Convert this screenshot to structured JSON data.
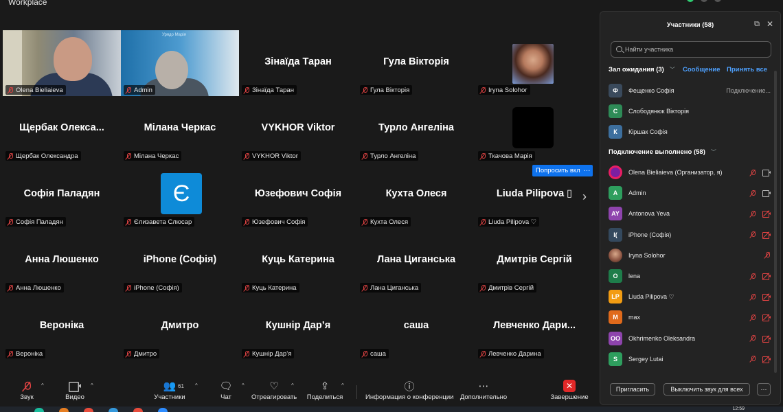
{
  "app_title": "Workplace",
  "gallery": {
    "tiles": [
      {
        "name": "Olena Bieliaieva",
        "display": "",
        "kind": "video1"
      },
      {
        "name": "Admin",
        "display": "",
        "kind": "video2"
      },
      {
        "name": "Зінаїда Таран",
        "display": "Зінаїда Таран",
        "kind": "name"
      },
      {
        "name": "Гула Вікторія",
        "display": "Гула Вікторія",
        "kind": "name"
      },
      {
        "name": "Iryna Solohor",
        "display": "",
        "kind": "photo"
      },
      {
        "name": "Щербак Олександра",
        "display": "Щербак  Олекса...",
        "kind": "name"
      },
      {
        "name": "Мілана Черкас",
        "display": "Мілана Черкас",
        "kind": "name"
      },
      {
        "name": "VYKHOR Viktor",
        "display": "VYKHOR Viktor",
        "kind": "name"
      },
      {
        "name": "Турло Ангеліна",
        "display": "Турло Ангеліна",
        "kind": "name"
      },
      {
        "name": "Ткачова Марія",
        "display": "",
        "kind": "black"
      },
      {
        "name": "Софія Паладян",
        "display": "Софія Паладян",
        "kind": "name"
      },
      {
        "name": "Єлизавета Слюсар",
        "display": "",
        "kind": "logo"
      },
      {
        "name": "Юзефович Софія",
        "display": "Юзефович Софія",
        "kind": "name"
      },
      {
        "name": "Кухта Олеся",
        "display": "Кухта Олеся",
        "kind": "name"
      },
      {
        "name": "Liuda Pilipova ♡",
        "display": "Liuda  Pilipova ▯",
        "kind": "name"
      },
      {
        "name": "Анна Люшенко",
        "display": "Анна Люшенко",
        "kind": "name"
      },
      {
        "name": "iPhone (Софія)",
        "display": "iPhone (Софія)",
        "kind": "name"
      },
      {
        "name": "Куць Катерина",
        "display": "Куць Катерина",
        "kind": "name"
      },
      {
        "name": "Лана Циганська",
        "display": "Лана Циганська",
        "kind": "name"
      },
      {
        "name": "Дмитрів Сергій",
        "display": "Дмитрів Сергій",
        "kind": "name"
      },
      {
        "name": "Вероніка",
        "display": "Вероніка",
        "kind": "name"
      },
      {
        "name": "Дмитро",
        "display": "Дмитро",
        "kind": "name"
      },
      {
        "name": "Кушнір Дар’я",
        "display": "Кушнір Дар’я",
        "kind": "name"
      },
      {
        "name": "саша",
        "display": "саша",
        "kind": "name"
      },
      {
        "name": "Левченко Дарина",
        "display": "Левченко  Дари...",
        "kind": "name"
      }
    ],
    "logo_letter": "Є",
    "video2_sign": "Урядо Марія",
    "ask_unmute": "Попросить вкл",
    "more": "···",
    "next": "›"
  },
  "toolbar": {
    "audio": "Звук",
    "video": "Видео",
    "participants": "Участники",
    "participants_count": "61",
    "chat": "Чат",
    "react": "Отреагировать",
    "share": "Поделиться",
    "info": "Информация о конференции",
    "more": "Дополнительно",
    "end": "Завершение"
  },
  "taskbar": {
    "clock": "12:59"
  },
  "panel": {
    "title": "Участники (58)",
    "search_placeholder": "Найти участника",
    "waiting": {
      "title": "Зал ожидания (3)",
      "message": "Сообщение",
      "admit_all": "Принять все",
      "items": [
        {
          "initial": "Ф",
          "name": "Фещенко Софія",
          "status": "Подключение...",
          "color": "#3a4a5c"
        },
        {
          "initial": "С",
          "name": "Слободянюк Вікторія",
          "status": "",
          "color": "#2e8b57"
        },
        {
          "initial": "К",
          "name": "Кіршак Софія",
          "status": "",
          "color": "#3d6f9e"
        }
      ]
    },
    "connected": {
      "title": "Подключение выполнено (58)",
      "items": [
        {
          "initial": "",
          "name": "Olena Bieliaieva (Организатор, я)",
          "color": "#c2185b",
          "cam": "on"
        },
        {
          "initial": "A",
          "name": "Admin",
          "color": "#2e9e5e",
          "cam": "on"
        },
        {
          "initial": "AY",
          "name": "Antonova Yeva",
          "color": "#8e44ad",
          "cam": "off"
        },
        {
          "initial": "I(",
          "name": "iPhone (Софія)",
          "color": "#34495e",
          "cam": "off"
        },
        {
          "initial": "",
          "name": "Iryna Solohor",
          "color": "#b07a5e",
          "cam": "none"
        },
        {
          "initial": "O",
          "name": "lena",
          "color": "#1e7d4a",
          "cam": "off"
        },
        {
          "initial": "LP",
          "name": "Liuda Pilipova ♡",
          "color": "#f39c12",
          "cam": "off"
        },
        {
          "initial": "M",
          "name": "max",
          "color": "#e06a1b",
          "cam": "off"
        },
        {
          "initial": "OO",
          "name": "Okhrimenko Oleksandra",
          "color": "#8e44ad",
          "cam": "off"
        },
        {
          "initial": "S",
          "name": "Sergey Lutai",
          "color": "#2e9e5e",
          "cam": "off"
        }
      ]
    },
    "invite": "Пригласить",
    "mute_all": "Выключить звук для всех",
    "more": "···"
  },
  "colors": {
    "accent": "#0e72ed",
    "link": "#4ea1ff",
    "muted": "#e04343",
    "end": "#e02828"
  }
}
